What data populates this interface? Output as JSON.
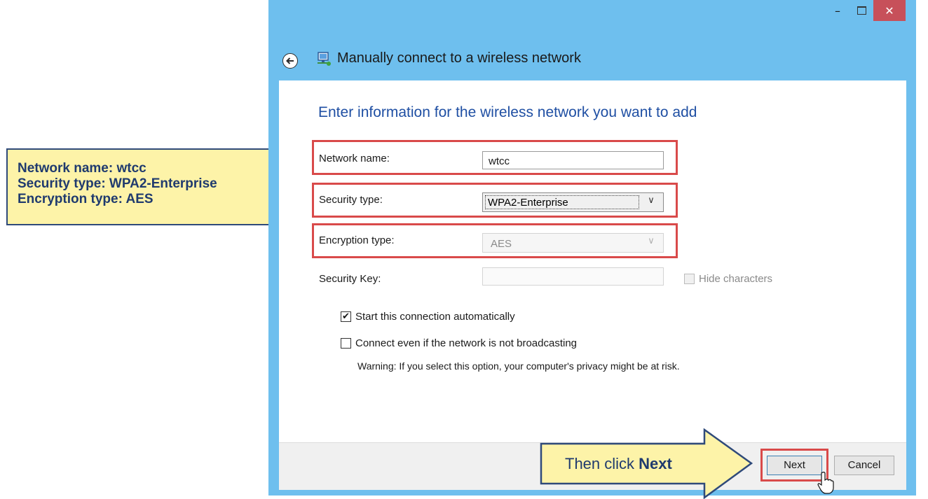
{
  "callout": {
    "line1": "Network name: wtcc",
    "line2": "Security type: WPA2-Enterprise",
    "line3": "Encryption type: AES"
  },
  "window": {
    "title_buttons": {
      "minimize": "–",
      "close": "✕"
    },
    "header_title": "Manually connect to a wireless network",
    "heading": "Enter information for the wireless network you want to add",
    "network_name": {
      "label": "Network name:",
      "value": "wtcc"
    },
    "security_type": {
      "label": "Security type:",
      "value": "WPA2-Enterprise"
    },
    "encryption_type": {
      "label": "Encryption type:",
      "value": "AES"
    },
    "security_key": {
      "label": "Security Key:",
      "value": "",
      "hide_label": "Hide characters"
    },
    "auto_start": {
      "label": "Start this connection automatically",
      "checked": true
    },
    "broadcast": {
      "label": "Connect even if the network is not broadcasting",
      "checked": false
    },
    "warning": "Warning: If you select this option, your computer's privacy might be at risk.",
    "buttons": {
      "next": "Next",
      "cancel": "Cancel"
    }
  },
  "arrow_callout": {
    "prefix": "Then click ",
    "bold": "Next"
  },
  "colors": {
    "titlebar": "#6ebfee",
    "close_button": "#c7505a",
    "highlight": "#d94a4a",
    "callout_bg": "#fdf3a8",
    "callout_text": "#1f3a6e",
    "heading": "#1f4fa3"
  }
}
